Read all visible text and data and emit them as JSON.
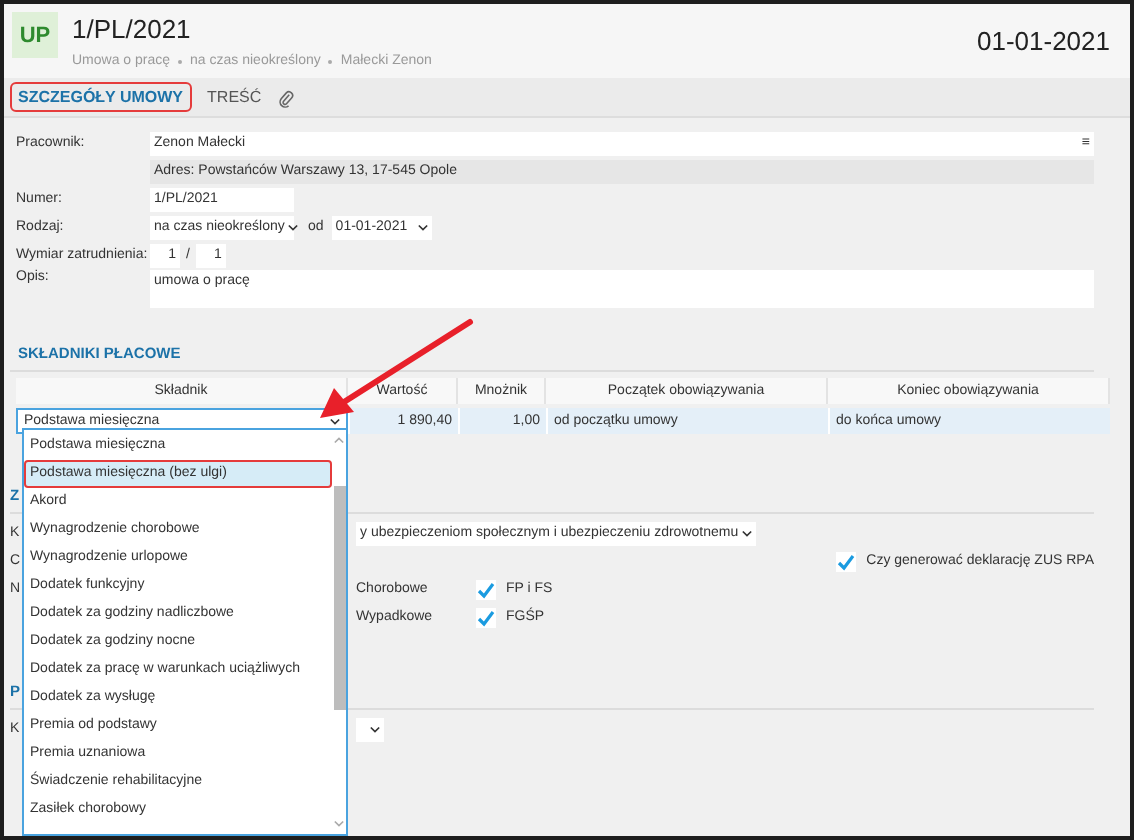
{
  "header": {
    "badge": "UP",
    "title": "1/PL/2021",
    "subtitle": [
      "Umowa o pracę",
      "na czas nieokreślony",
      "Małecki Zenon"
    ],
    "date": "01-01-2021"
  },
  "tabs": [
    {
      "label": "SZCZEGÓŁY UMOWY",
      "selected": true,
      "highlighted": true
    },
    {
      "label": "TREŚĆ",
      "selected": false,
      "highlighted": false
    }
  ],
  "form": {
    "employee": {
      "label": "Pracownik:",
      "value": "Zenon Małecki",
      "menu_glyph": "≡",
      "address": "Adres:  Powstańców Warszawy 13, 17-545 Opole"
    },
    "number": {
      "label": "Numer:",
      "value": "1/PL/2021"
    },
    "type": {
      "label": "Rodzaj:",
      "value": "na czas nieokreślony",
      "from_label": "od",
      "from_value": "01-01-2021"
    },
    "working_time": {
      "label": "Wymiar zatrudnienia:",
      "numerator": "1",
      "separator": "/",
      "denominator": "1"
    },
    "description": {
      "label": "Opis:",
      "value": "umowa o pracę"
    }
  },
  "pay_components": {
    "heading": "SKŁADNIKI PŁACOWE",
    "columns": [
      "Składnik",
      "Wartość",
      "Mnożnik",
      "Początek obowiązywania",
      "Koniec obowiązywania"
    ],
    "rows": [
      {
        "component": "Podstawa miesięczna",
        "value": "1 890,40",
        "multiplier": "1,00",
        "start": "od początku umowy",
        "end": "do końca umowy"
      }
    ],
    "dropdown": [
      {
        "label": "Podstawa miesięczna",
        "selected": false,
        "highlighted": false
      },
      {
        "label": "Podstawa miesięczna (bez ulgi)",
        "selected": true,
        "highlighted": true
      },
      {
        "label": "Akord",
        "selected": false,
        "highlighted": false
      },
      {
        "label": "Wynagrodzenie chorobowe",
        "selected": false,
        "highlighted": false
      },
      {
        "label": "Wynagrodzenie urlopowe",
        "selected": false,
        "highlighted": false
      },
      {
        "label": "Dodatek funkcyjny",
        "selected": false,
        "highlighted": false
      },
      {
        "label": "Dodatek za godziny nadliczbowe",
        "selected": false,
        "highlighted": false
      },
      {
        "label": "Dodatek za godziny nocne",
        "selected": false,
        "highlighted": false
      },
      {
        "label": "Dodatek za pracę w warunkach uciążliwych",
        "selected": false,
        "highlighted": false
      },
      {
        "label": "Dodatek za wysługę",
        "selected": false,
        "highlighted": false
      },
      {
        "label": "Premia od podstawy",
        "selected": false,
        "highlighted": false
      },
      {
        "label": "Premia uznaniowa",
        "selected": false,
        "highlighted": false
      },
      {
        "label": "Świadczenie rehabilitacyjne",
        "selected": false,
        "highlighted": false
      },
      {
        "label": "Zasiłek chorobowy",
        "selected": false,
        "highlighted": false
      }
    ]
  },
  "insurance": {
    "heading": "Z",
    "type_label": "K",
    "type_value": "y ubezpieczeniom społecznym i ubezpieczeniu zdrowotnemu",
    "row2_label": "C",
    "rpa": {
      "label": "Czy generować deklarację ZUS RPA",
      "checked": true
    },
    "row3_label": "N",
    "insurances": [
      {
        "label": "Chorobowe",
        "fund": "FP i FS",
        "checked": true
      },
      {
        "label": "Wypadkowe",
        "fund": "FGŚP",
        "checked": true
      }
    ]
  },
  "section_p": {
    "heading": "P",
    "label": "K"
  }
}
